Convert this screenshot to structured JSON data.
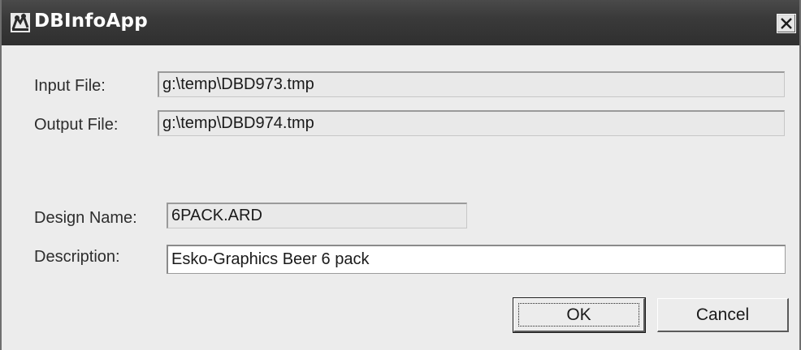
{
  "window": {
    "title": "DBInfoApp"
  },
  "form": {
    "input_file_label": "Input File:",
    "input_file_value": "g:\\temp\\DBD973.tmp",
    "output_file_label": "Output File:",
    "output_file_value": "g:\\temp\\DBD974.tmp",
    "design_name_label": "Design Name:",
    "design_name_value": "6PACK.ARD",
    "description_label": "Description:",
    "description_value": "Esko-Graphics Beer 6 pack"
  },
  "buttons": {
    "ok_label": "OK",
    "cancel_label": "Cancel"
  },
  "icons": {
    "app": "app-icon",
    "close": "close-icon"
  }
}
